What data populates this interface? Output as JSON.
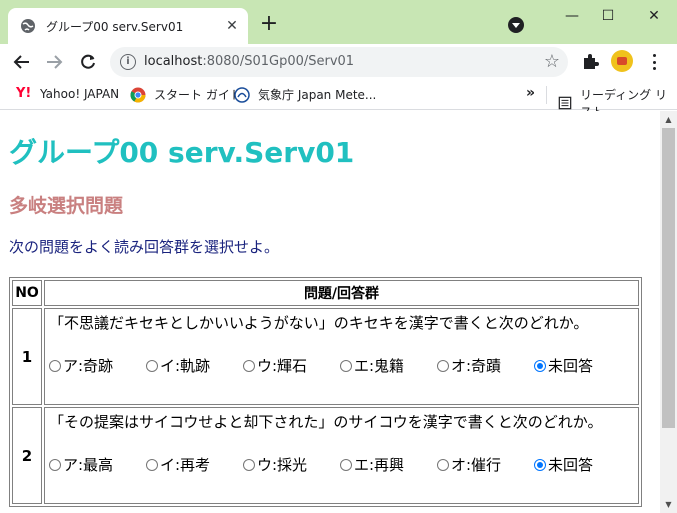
{
  "browser": {
    "tab_title": "グループ00 serv.Serv01",
    "tab_close": "✕",
    "new_tab": "+",
    "url_host": "localhost",
    "url_path": ":8080/S01Gp00/Serv01",
    "window_minimize": "—",
    "window_maximize": "☐",
    "window_close": "✕"
  },
  "bookmarks": {
    "items": [
      {
        "label": "Yahoo! JAPAN",
        "icon": "yahoo-icon"
      },
      {
        "label": "スタート ガイド",
        "icon": "chrome-icon"
      },
      {
        "label": "気象庁 Japan Mete...",
        "icon": "jma-icon"
      }
    ],
    "more": "»",
    "reading_list": "リーディング リスト"
  },
  "page": {
    "title": "グループ00 serv.Serv01",
    "subtitle": "多岐選択問題",
    "instruction": "次の問題をよく読み回答群を選択せよ。",
    "table": {
      "header_no": "NO",
      "header_question": "問題/回答群",
      "rows": [
        {
          "no": "1",
          "question": "「不思議だキセキとしかいいようがない」のキセキを漢字で書くと次のどれか。",
          "choices": [
            "ア:奇跡",
            "イ:軌跡",
            "ウ:輝石",
            "エ:鬼籍",
            "オ:奇蹟",
            "未回答"
          ],
          "selected": 5
        },
        {
          "no": "2",
          "question": "「その提案はサイコウせよと却下された」のサイコウを漢字で書くと次のどれか。",
          "choices": [
            "ア:最高",
            "イ:再考",
            "ウ:採光",
            "エ:再興",
            "オ:催行",
            "未回答"
          ],
          "selected": 5
        }
      ]
    }
  },
  "colors": {
    "title": "#20c0c0",
    "subtitle": "#c98080",
    "instruction": "#1a237e",
    "tabbar": "#c8e6b4",
    "radio_checked": "#0075ff"
  }
}
